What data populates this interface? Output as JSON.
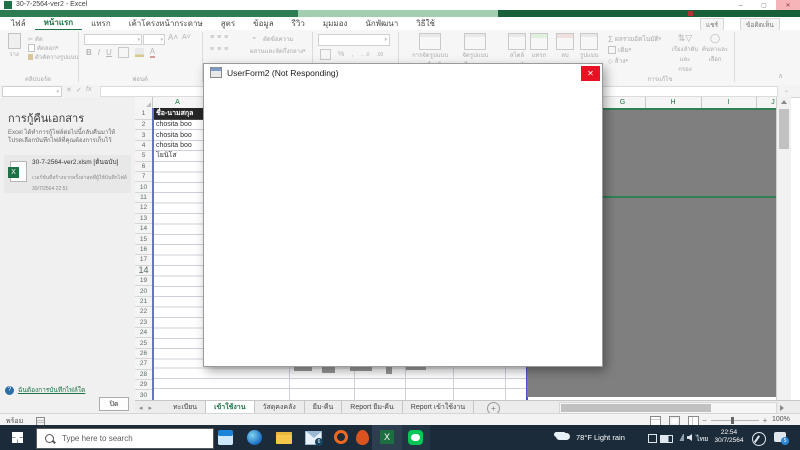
{
  "window": {
    "title": "30-7-2564-ver2 - Excel"
  },
  "ribbon": {
    "tabs": [
      "ไฟล์",
      "หน้าแรก",
      "แทรก",
      "เค้าโครงหน้ากระดาษ",
      "สูตร",
      "ข้อมูล",
      "รีวิว",
      "มุมมอง",
      "นักพัฒนา",
      "วิธีใช้"
    ],
    "active_tab": "หน้าแรก",
    "share": "แชร์",
    "comments": "ข้อคิดเห็น",
    "clipboard": {
      "label": "คลิปบอร์ด",
      "paste": "วาง",
      "cut": "ตัด",
      "copy": "คัดลอก",
      "painter": "ตัวคัดวางรูปแบบ"
    },
    "font": {
      "label": "ฟอนต์",
      "bold": "B",
      "italic": "I",
      "underline": "U"
    },
    "alignment": {
      "wrap": "ตัดข้อความ",
      "merge": "ผสานและจัดกึ่งกลาง"
    },
    "number": {
      "pct": "%",
      "comma": ",",
      "dec0": "←.0",
      "dec00": ".00"
    },
    "styles": {
      "cond_l1": "การจัดรูปแบบ",
      "cond_l2": "ตามเงื่อนไข",
      "table_l1": "จัดรูปแบบ",
      "table_l2": "เป็นตาราง",
      "cellstyle_l1": "สไตล์",
      "cellstyle_l2": "เซลล์"
    },
    "cells": {
      "insert": "แทรก",
      "delete": "ลบ",
      "format": "รูปแบบ"
    },
    "editing": {
      "label": "การแก้ไข",
      "autosum": "ผลรวมอัตโนมัติ",
      "fill": "เติม",
      "clear": "ล้าง",
      "sort_l1": "เรียงลำดับและ",
      "sort_l2": "กรอง",
      "find_l1": "ค้นหาและ",
      "find_l2": "เลือก"
    }
  },
  "formula_bar": {
    "cancel": "✕",
    "enter": "✓",
    "fx": "fx"
  },
  "recovery": {
    "title": "การกู้คืนเอกสาร",
    "desc": "Excel ได้ทำการกู้ไฟล์ต่อไปนี้กลับคืนมาให้ โปรดเลือกบันทึกไฟล์ที่คุณต้องการเก็บไว้",
    "file_name": "30-7-2564-ver2.xlsm [ต้นฉบับ]",
    "file_desc": "เวอร์ชันที่สร้างจากครั้งล่าสุดที่ผู้ใช้บันทึกไฟล์",
    "file_time": "30/7/2564 22:51",
    "help_link": "ฉันต้องการบันทึกไฟล์ใด",
    "close_label": "ปิด"
  },
  "dialog": {
    "title": "UserForm2 (Not Responding)",
    "close": "✕"
  },
  "sheet": {
    "col_left": "A",
    "cols_right": [
      "G",
      "H",
      "I",
      "J"
    ],
    "rows": [
      "1",
      "2",
      "3",
      "4",
      "5",
      "6",
      "7",
      "10",
      "11",
      "12",
      "13",
      "14",
      "15",
      "16",
      "17",
      "14",
      "19",
      "20",
      "21",
      "22",
      "23",
      "24",
      "25",
      "26",
      "27",
      "28",
      "29",
      "30"
    ],
    "big_row_index": 15,
    "a1": "ชื่อ-นามสกุล",
    "a2": "chosita boo",
    "a3": "chosita boo",
    "a4": "chosita boo",
    "a5": "โยนิโส"
  },
  "sheet_tabs": {
    "tabs": [
      "ทะเบียน",
      "เข้าใช้งาน",
      "วัสดุคงคลัง",
      "ยืม-คืน",
      "Report ยืม-คืน",
      "Report เข้าใช้งาน"
    ],
    "active": "เข้าใช้งาน",
    "add": "+"
  },
  "status_bar": {
    "ready": "พร้อม",
    "zoom": "100%"
  },
  "taskbar": {
    "search_placeholder": "Type here to search",
    "weather": "78°F Light rain",
    "language": "ไทย",
    "time": "22:54",
    "date": "30/7/2564",
    "mail_badge": "6",
    "notif_badge": "5"
  },
  "glyphs": {
    "min": "–",
    "max": "▢",
    "close": "✕",
    "caret": "▾",
    "chev": "∧",
    "sum": "Σ",
    "scissors": "✂",
    "menu_dots": "⋮"
  },
  "colors": {
    "excel_green": "#1e7145",
    "dialog_close_red": "#e81123",
    "taskbar": "#1c2b3a",
    "gray_block": "#7f7f7f"
  }
}
